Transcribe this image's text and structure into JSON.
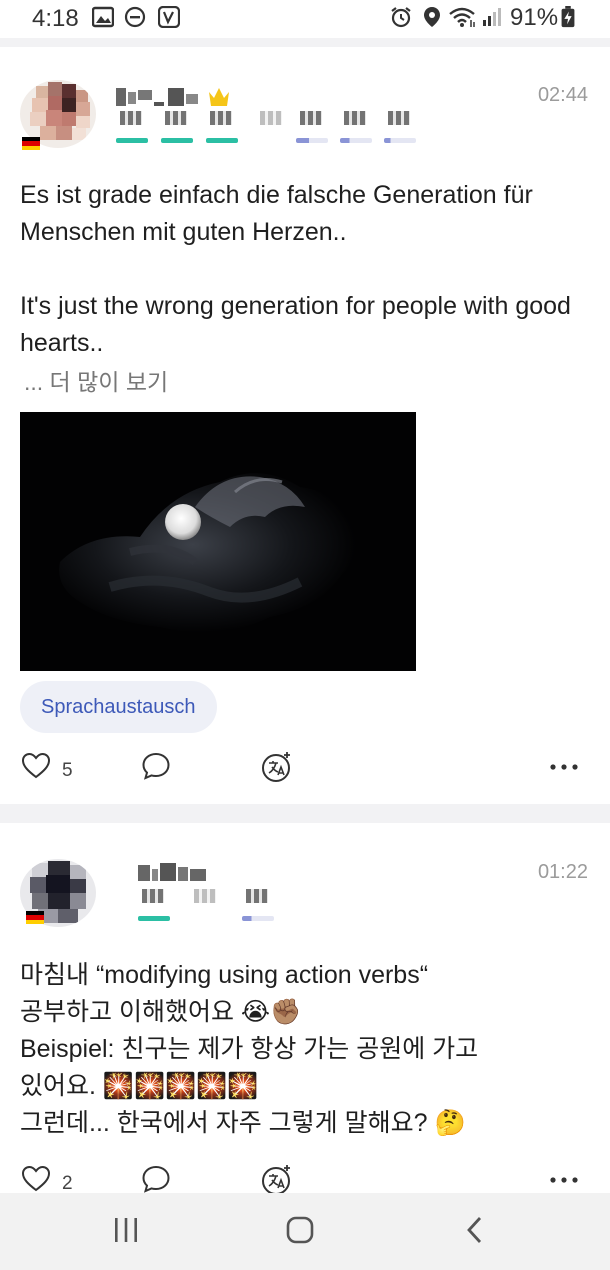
{
  "status_bar": {
    "time": "4:18",
    "battery": "91%",
    "icons": [
      "image-icon",
      "do-not-disturb-icon",
      "vine-icon",
      "alarm-icon",
      "location-icon",
      "wifi-icon",
      "signal-icon",
      "battery-charging-icon"
    ]
  },
  "posts": [
    {
      "time": "02:44",
      "text": "Es ist grade einfach die falsche Generation für Menschen mit guten Herzen..\n\nIt's just the wrong generation for people with good hearts..",
      "more": "... 더 많이 보기",
      "tag": "Sprachaustausch",
      "likes": "5",
      "colors": {
        "native_bar": "#2bbfa4",
        "learning_bar": "#8a94d6"
      }
    },
    {
      "time": "01:22",
      "text": "마침내 “modifying using action verbs“\n공부하고 이해했어요 😭✊🏽\nBeispiel: 친구는 제가 항상 가는 공원에 가고\n있어요. 🎇🎇🎇🎇🎇\n그런데... 한국에서 자주 그렇게 말해요? 🤔",
      "likes": "2"
    }
  ],
  "nav": {
    "buttons": [
      "recent-apps-icon",
      "home-icon",
      "back-icon"
    ]
  }
}
